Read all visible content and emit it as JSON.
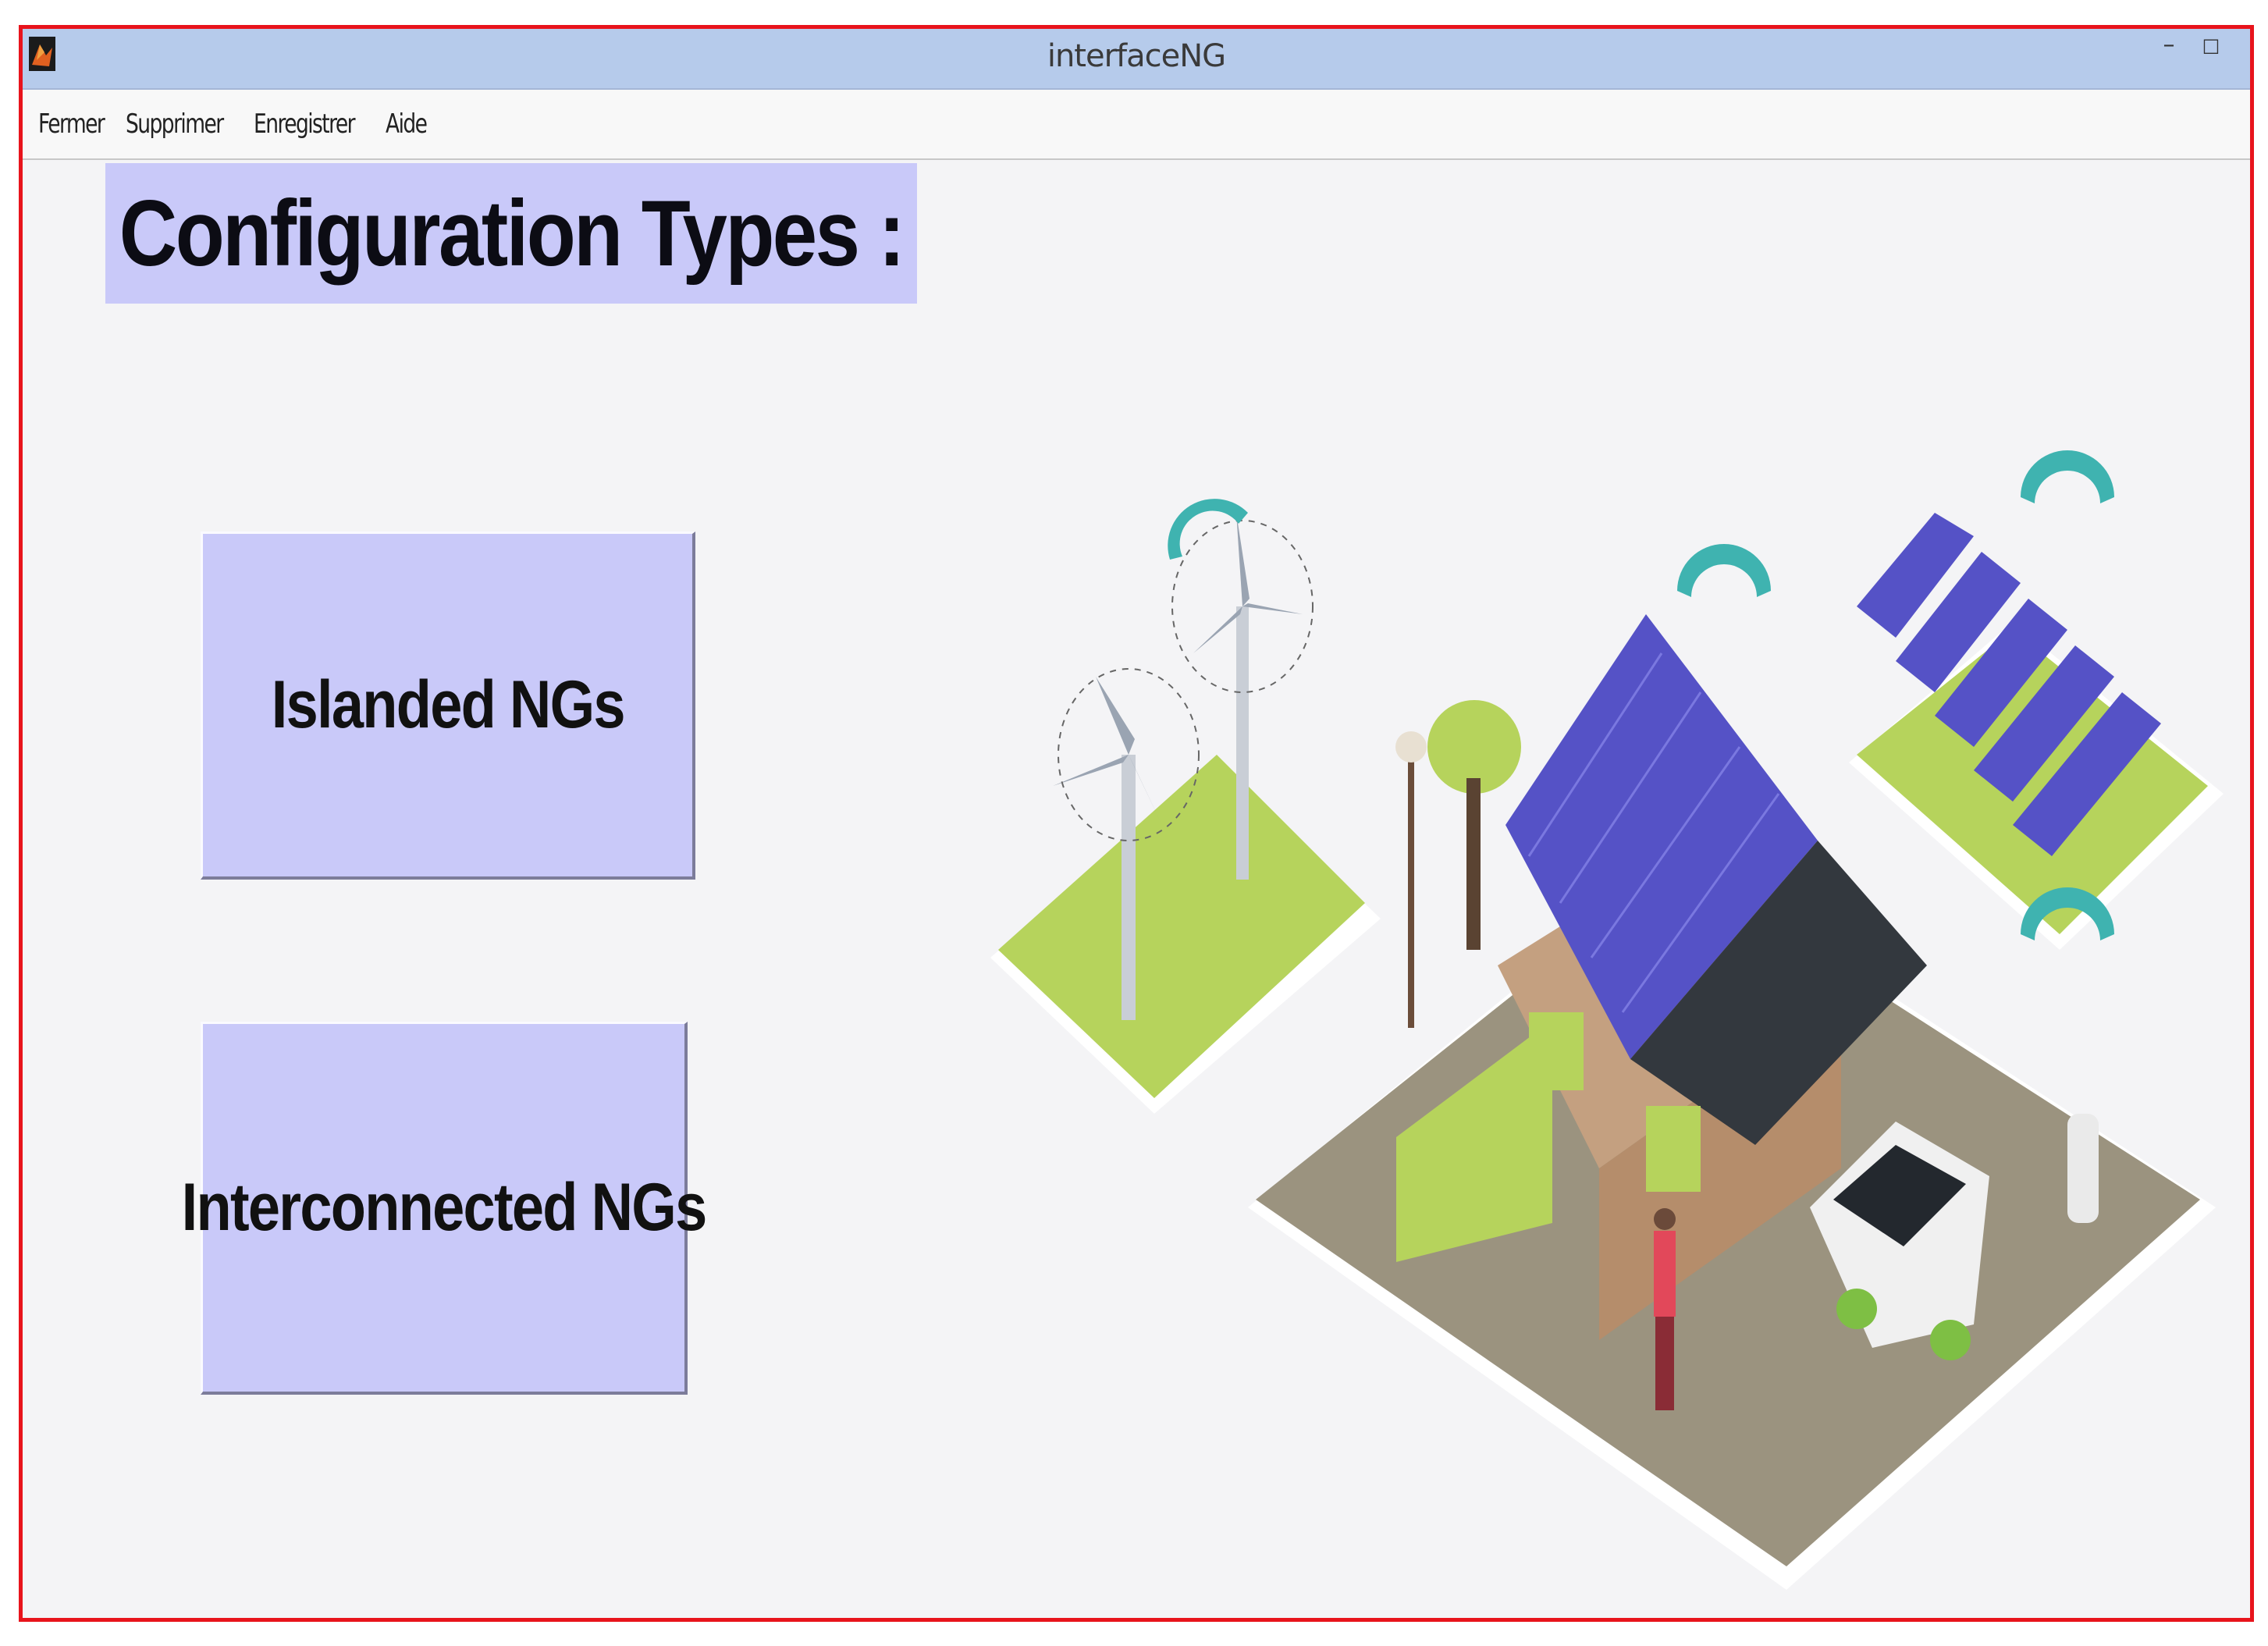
{
  "window": {
    "title": "interfaceNG",
    "minimize_glyph": "–",
    "maximize_glyph": "□"
  },
  "menu": {
    "items": [
      "Fermer",
      "Supprimer",
      "Enregistrer",
      "Aide"
    ]
  },
  "main": {
    "heading": "Configuration Types :",
    "buttons": {
      "islanded": "Islanded NGs",
      "interconnected": "Interconnected NGs"
    }
  },
  "colors": {
    "frame_border": "#e8141c",
    "titlebar": "#b6cbeb",
    "button_fill": "#c9c9f9",
    "background": "#f4f4f6"
  },
  "icons": [
    "matlab-app-icon",
    "wind-turbine-icon",
    "solar-house-icon",
    "solar-panel-array-icon",
    "wifi-signal-icon",
    "electric-car-icon"
  ]
}
